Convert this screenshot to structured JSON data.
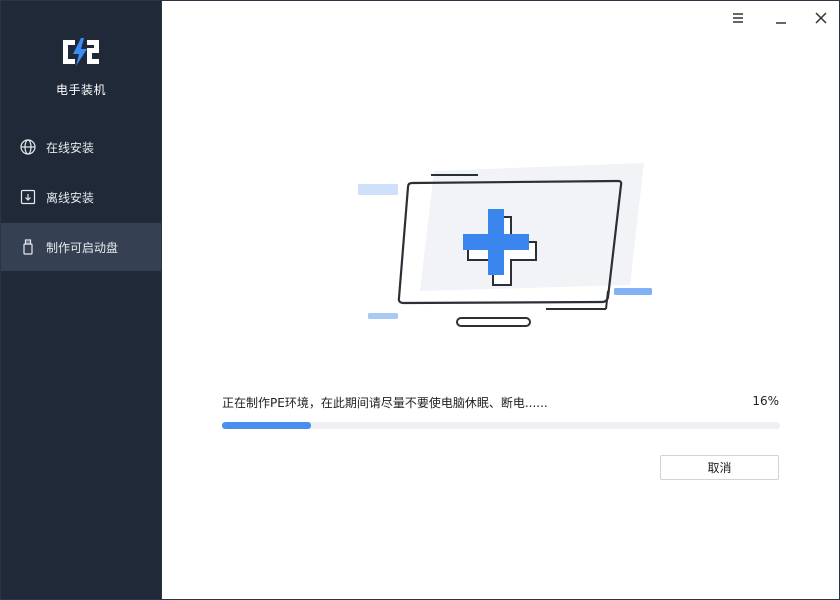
{
  "app": {
    "title": "电手装机",
    "logo_icon": "lightning-c-logo-icon"
  },
  "sidebar": {
    "items": [
      {
        "label": "在线安装",
        "icon": "globe-icon",
        "active": false
      },
      {
        "label": "离线安装",
        "icon": "download-box-icon",
        "active": false
      },
      {
        "label": "制作可启动盘",
        "icon": "usb-drive-icon",
        "active": true
      }
    ]
  },
  "window_controls": {
    "menu_icon": "menu-icon",
    "minimize_icon": "minimize-icon",
    "close_icon": "close-icon"
  },
  "progress": {
    "message": "正在制作PE环境，在此期间请尽量不要使电脑休眠、断电......",
    "percent_label": "16%",
    "value": 16
  },
  "actions": {
    "cancel_label": "取消"
  },
  "colors": {
    "sidebar_bg": "#1f2937",
    "sidebar_active": "#354052",
    "accent": "#4a8ff0"
  }
}
